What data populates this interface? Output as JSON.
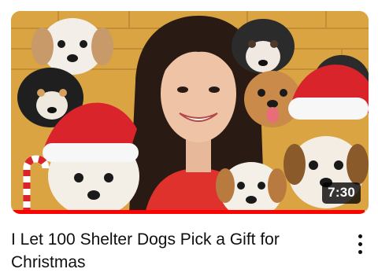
{
  "video": {
    "duration": "7:30",
    "title": "I Let 100 Shelter Dogs Pick a Gift for Christmas",
    "watched_fraction": 0.99
  },
  "colors": {
    "progress": "#ff0000",
    "wall": "#d9a441"
  },
  "icons": {
    "menu": "more-vertical-icon"
  }
}
